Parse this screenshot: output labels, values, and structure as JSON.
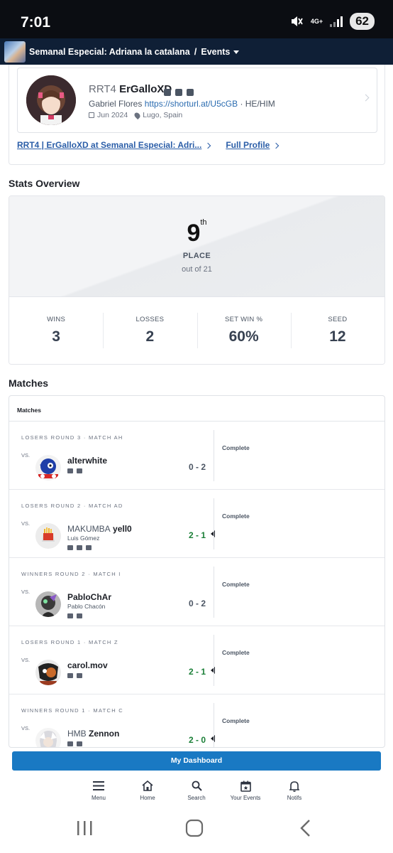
{
  "status_bar": {
    "time": "7:01",
    "network": "4G+",
    "battery": "62"
  },
  "header": {
    "event_title": "Semanal Especial: Adriana la catalana",
    "separator": "/",
    "section": "Events"
  },
  "profile": {
    "prefix": "RRT4",
    "gamer_tag": "ErGalloXD",
    "real_name": "Gabriel Flores",
    "url": "https://shorturl.at/U5cGB",
    "pronouns": "· HE/HIM",
    "joined": "Jun 2024",
    "location": "Lugo, Spain",
    "entrant_link": "RRT4 | ErGalloXD at Semanal Especial: Adri...",
    "full_profile_link": "Full Profile",
    "social_icons": [
      "twitch-icon",
      "twitter-icon",
      "discord-icon"
    ]
  },
  "stats": {
    "title": "Stats Overview",
    "place": "9",
    "place_suffix": "th",
    "place_label": "PLACE",
    "place_sub": "out of 21",
    "items": [
      {
        "label": "WINS",
        "value": "3"
      },
      {
        "label": "LOSSES",
        "value": "2"
      },
      {
        "label": "SET WIN %",
        "value": "60%"
      },
      {
        "label": "SEED",
        "value": "12"
      }
    ]
  },
  "matches": {
    "title": "Matches",
    "header": "Matches",
    "vs_label": "VS.",
    "rows": [
      {
        "round": "LOSERS ROUND 3 · MATCH AH",
        "prefix": "",
        "name": "alterwhite",
        "real_name": "",
        "score": "0 - 2",
        "won": false,
        "status": "Complete"
      },
      {
        "round": "LOSERS ROUND 2 · MATCH AD",
        "prefix": "MAKUMBA",
        "name": "yell0",
        "real_name": "Luis Gómez",
        "score": "2 - 1",
        "won": true,
        "status": "Complete"
      },
      {
        "round": "WINNERS ROUND 2 · MATCH I",
        "prefix": "",
        "name": "PabloChAr",
        "real_name": "Pablo Chacón",
        "score": "0 - 2",
        "won": false,
        "status": "Complete"
      },
      {
        "round": "LOSERS ROUND 1 · MATCH Z",
        "prefix": "",
        "name": "carol.mov",
        "real_name": "",
        "score": "2 - 1",
        "won": true,
        "status": "Complete"
      },
      {
        "round": "WINNERS ROUND 1 · MATCH C",
        "prefix": "HMB",
        "name": "Zennon",
        "real_name": "",
        "score": "2 - 0",
        "won": true,
        "status": "Complete"
      }
    ]
  },
  "dashboard_button": "My Dashboard",
  "bottom_nav": [
    {
      "label": "Menu",
      "icon": "menu-icon"
    },
    {
      "label": "Home",
      "icon": "home-icon"
    },
    {
      "label": "Search",
      "icon": "search-icon"
    },
    {
      "label": "Your Events",
      "icon": "calendar-star-icon"
    },
    {
      "label": "Notifs",
      "icon": "bell-icon"
    }
  ],
  "colors": {
    "accent": "#1979c3",
    "header_bg": "#0f1f36",
    "win": "#1a7f37",
    "link": "#2b5ea8"
  }
}
